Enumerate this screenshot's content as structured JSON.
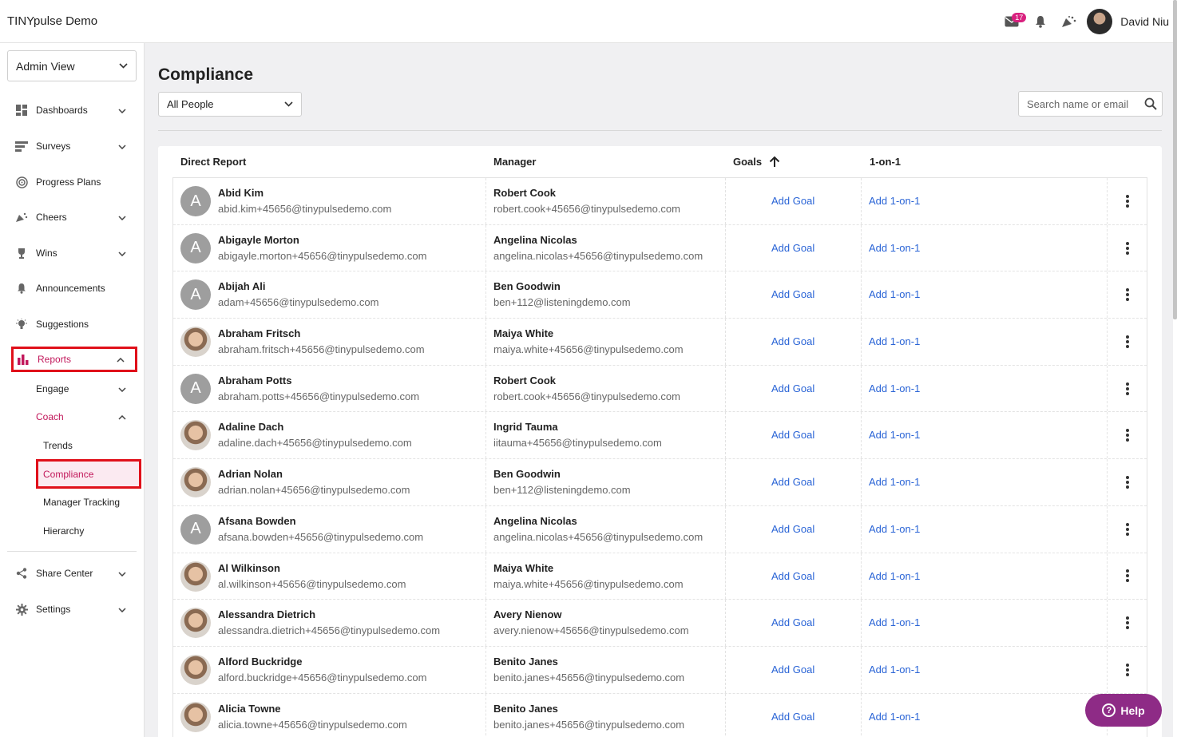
{
  "app": {
    "title": "TINYpulse Demo"
  },
  "topbar": {
    "mail_count": "17",
    "user_name": "David Niu"
  },
  "sidebar": {
    "view": "Admin View",
    "items": [
      {
        "label": "Dashboards",
        "icon": "dashboard-icon"
      },
      {
        "label": "Surveys",
        "icon": "survey-icon"
      },
      {
        "label": "Progress Plans",
        "icon": "target-icon"
      },
      {
        "label": "Cheers",
        "icon": "cheers-icon"
      },
      {
        "label": "Wins",
        "icon": "trophy-icon"
      },
      {
        "label": "Announcements",
        "icon": "bell-icon"
      },
      {
        "label": "Suggestions",
        "icon": "lightbulb-icon"
      },
      {
        "label": "Reports",
        "icon": "bar-chart-icon"
      }
    ],
    "reports_sub": {
      "engage": "Engage",
      "coach": "Coach"
    },
    "coach_sub": [
      "Trends",
      "Compliance",
      "Manager Tracking",
      "Hierarchy"
    ],
    "bottom": [
      {
        "label": "Share Center",
        "icon": "share-icon"
      },
      {
        "label": "Settings",
        "icon": "gear-icon"
      }
    ]
  },
  "main": {
    "title": "Compliance",
    "filter": "All People",
    "search_placeholder": "Search name or email",
    "columns": {
      "direct_report": "Direct Report",
      "manager": "Manager",
      "goals": "Goals",
      "one_on_one": "1-on-1"
    },
    "add_goal": "Add Goal",
    "add_one_on_one": "Add 1-on-1",
    "rows": [
      {
        "name": "Abid Kim",
        "email": "abid.kim+45656@tinypulsedemo.com",
        "manager": "Robert Cook",
        "manager_email": "robert.cook+45656@tinypulsedemo.com",
        "avatar": "A"
      },
      {
        "name": "Abigayle Morton",
        "email": "abigayle.morton+45656@tinypulsedemo.com",
        "manager": "Angelina Nicolas",
        "manager_email": "angelina.nicolas+45656@tinypulsedemo.com",
        "avatar": "A"
      },
      {
        "name": "Abijah Ali",
        "email": "adam+45656@tinypulsedemo.com",
        "manager": "Ben Goodwin",
        "manager_email": "ben+112@listeningdemo.com",
        "avatar": "A"
      },
      {
        "name": "Abraham Fritsch",
        "email": "abraham.fritsch+45656@tinypulsedemo.com",
        "manager": "Maiya White",
        "manager_email": "maiya.white+45656@tinypulsedemo.com",
        "avatar": ""
      },
      {
        "name": "Abraham Potts",
        "email": "abraham.potts+45656@tinypulsedemo.com",
        "manager": "Robert Cook",
        "manager_email": "robert.cook+45656@tinypulsedemo.com",
        "avatar": "A"
      },
      {
        "name": "Adaline Dach",
        "email": "adaline.dach+45656@tinypulsedemo.com",
        "manager": "Ingrid Tauma",
        "manager_email": "iitauma+45656@tinypulsedemo.com",
        "avatar": ""
      },
      {
        "name": "Adrian Nolan",
        "email": "adrian.nolan+45656@tinypulsedemo.com",
        "manager": "Ben Goodwin",
        "manager_email": "ben+112@listeningdemo.com",
        "avatar": ""
      },
      {
        "name": "Afsana Bowden",
        "email": "afsana.bowden+45656@tinypulsedemo.com",
        "manager": "Angelina Nicolas",
        "manager_email": "angelina.nicolas+45656@tinypulsedemo.com",
        "avatar": "A"
      },
      {
        "name": "Al Wilkinson",
        "email": "al.wilkinson+45656@tinypulsedemo.com",
        "manager": "Maiya White",
        "manager_email": "maiya.white+45656@tinypulsedemo.com",
        "avatar": ""
      },
      {
        "name": "Alessandra Dietrich",
        "email": "alessandra.dietrich+45656@tinypulsedemo.com",
        "manager": "Avery Nienow",
        "manager_email": "avery.nienow+45656@tinypulsedemo.com",
        "avatar": ""
      },
      {
        "name": "Alford Buckridge",
        "email": "alford.buckridge+45656@tinypulsedemo.com",
        "manager": "Benito Janes",
        "manager_email": "benito.janes+45656@tinypulsedemo.com",
        "avatar": ""
      },
      {
        "name": "Alicia Towne",
        "email": "alicia.towne+45656@tinypulsedemo.com",
        "manager": "Benito Janes",
        "manager_email": "benito.janes+45656@tinypulsedemo.com",
        "avatar": ""
      }
    ]
  },
  "help": {
    "label": "Help"
  }
}
